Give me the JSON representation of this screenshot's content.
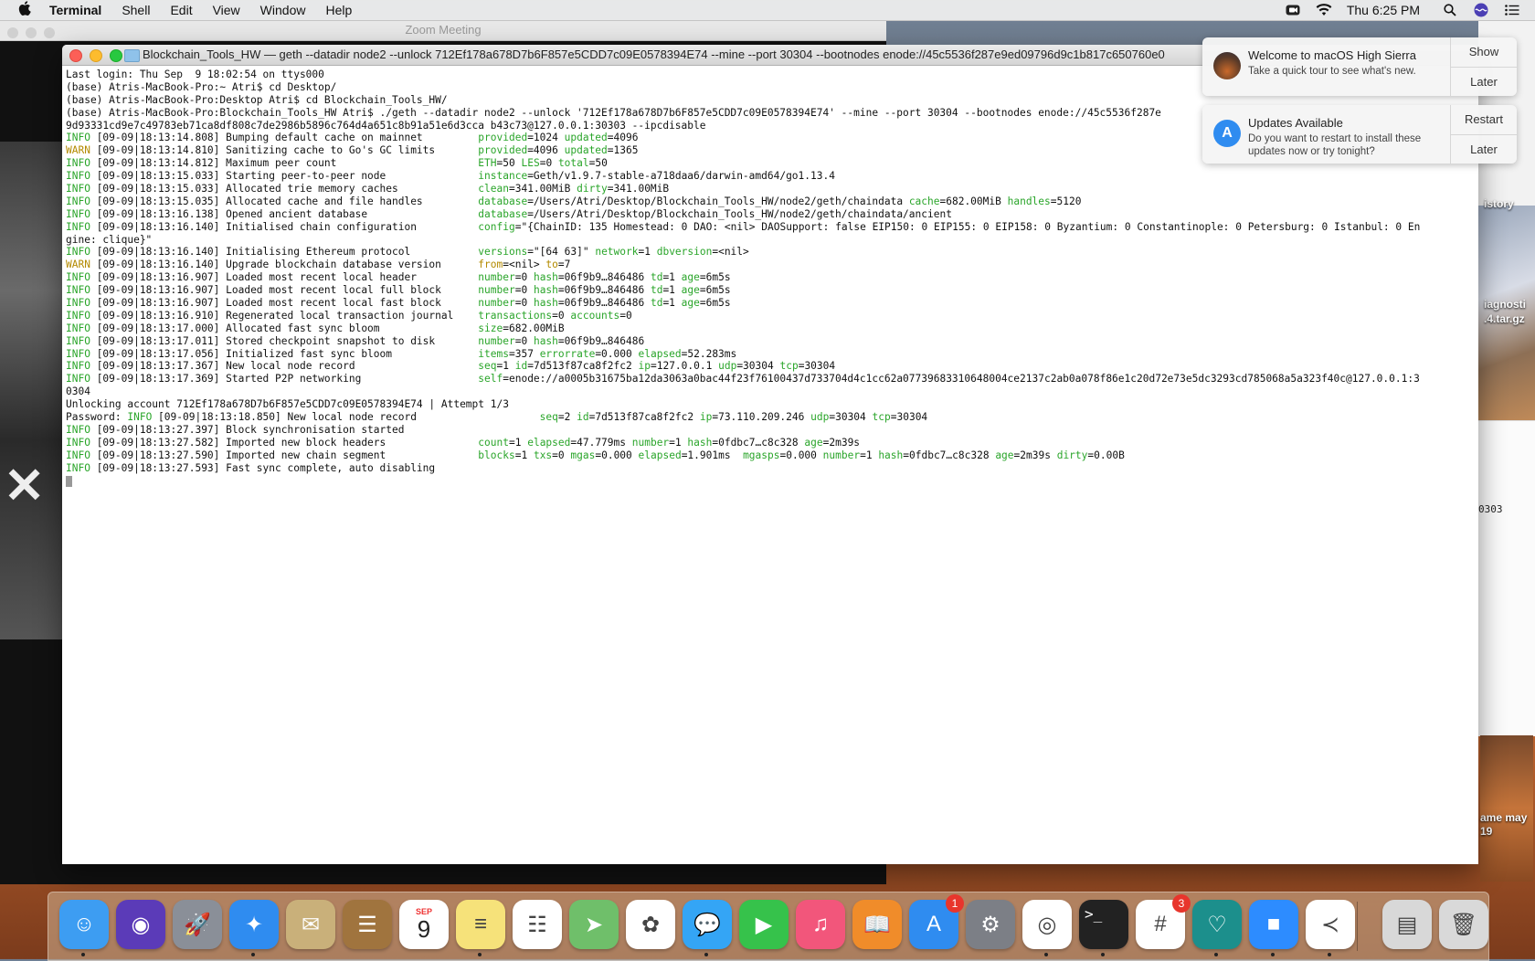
{
  "menubar": {
    "app_name": "Terminal",
    "items": [
      "Shell",
      "Edit",
      "View",
      "Window",
      "Help"
    ],
    "clock": "Thu 6:25 PM"
  },
  "zoom": {
    "title": "Zoom Meeting"
  },
  "terminal": {
    "title": "Blockchain_Tools_HW — geth --datadir node2 --unlock 712Ef178a678D7b6F857e5CDD7c09E0578394E74 --mine --port 30304 --bootnodes enode://45c5536f287e9ed09796d9c1b817c650760e0",
    "lines": [
      {
        "t": "Last login: Thu Sep  9 18:02:54 on ttys000"
      },
      {
        "t": "(base) Atris-MacBook-Pro:~ Atri$ cd Desktop/"
      },
      {
        "t": "(base) Atris-MacBook-Pro:Desktop Atri$ cd Blockchain_Tools_HW/"
      },
      {
        "t": "(base) Atris-MacBook-Pro:Blockchain_Tools_HW Atri$ ./geth --datadir node2 --unlock '712Ef178a678D7b6F857e5CDD7c09E0578394E74' --mine --port 30304 --bootnodes enode://45c5536f287e"
      },
      {
        "t": "9d93331cd9e7c49783eb71ca8df808c7de2986b5896c764d4a651c8b91a51e6d3cca b43c73@127.0.0.1:30303 --ipcdisable"
      },
      {
        "lvl": "INFO",
        "t": " [09-09|18:13:14.808] Bumping default cache on mainnet         ",
        "kv": "provided=1024 updated=4096"
      },
      {
        "lvl": "WARN",
        "t": " [09-09|18:13:14.810] Sanitizing cache to Go's GC limits       ",
        "kv": "provided=4096 updated=1365"
      },
      {
        "lvl": "INFO",
        "t": " [09-09|18:13:14.812] Maximum peer count                       ",
        "kv": "ETH=50 LES=0 total=50"
      },
      {
        "lvl": "INFO",
        "t": " [09-09|18:13:15.033] Starting peer-to-peer node               ",
        "kv": "instance=Geth/v1.9.7-stable-a718daa6/darwin-amd64/go1.13.4"
      },
      {
        "lvl": "INFO",
        "t": " [09-09|18:13:15.033] Allocated trie memory caches             ",
        "kv": "clean=341.00MiB dirty=341.00MiB"
      },
      {
        "lvl": "INFO",
        "t": " [09-09|18:13:15.035] Allocated cache and file handles         ",
        "kv": "database=/Users/Atri/Desktop/Blockchain_Tools_HW/node2/geth/chaindata cache=682.00MiB handles=5120"
      },
      {
        "lvl": "INFO",
        "t": " [09-09|18:13:16.138] Opened ancient database                  ",
        "kv": "database=/Users/Atri/Desktop/Blockchain_Tools_HW/node2/geth/chaindata/ancient"
      },
      {
        "lvl": "INFO",
        "t": " [09-09|18:13:16.140] Initialised chain configuration          ",
        "kv": "config=\"{ChainID: 135 Homestead: 0 DAO: <nil> DAOSupport: false EIP150: 0 EIP155: 0 EIP158: 0 Byzantium: 0 Constantinople: 0 Petersburg: 0 Istanbul: 0 En"
      },
      {
        "t": "gine: clique}\""
      },
      {
        "lvl": "INFO",
        "t": " [09-09|18:13:16.140] Initialising Ethereum protocol           ",
        "kv": "versions=\"[64 63]\" network=1 dbversion=<nil>"
      },
      {
        "lvl": "WARN",
        "t": " [09-09|18:13:16.140] Upgrade blockchain database version      ",
        "kv": "from=<nil> to=7"
      },
      {
        "lvl": "INFO",
        "t": " [09-09|18:13:16.907] Loaded most recent local header          ",
        "kv": "number=0 hash=06f9b9…846486 td=1 age=6m5s"
      },
      {
        "lvl": "INFO",
        "t": " [09-09|18:13:16.907] Loaded most recent local full block      ",
        "kv": "number=0 hash=06f9b9…846486 td=1 age=6m5s"
      },
      {
        "lvl": "INFO",
        "t": " [09-09|18:13:16.907] Loaded most recent local fast block      ",
        "kv": "number=0 hash=06f9b9…846486 td=1 age=6m5s"
      },
      {
        "lvl": "INFO",
        "t": " [09-09|18:13:16.910] Regenerated local transaction journal    ",
        "kv": "transactions=0 accounts=0"
      },
      {
        "lvl": "INFO",
        "t": " [09-09|18:13:17.000] Allocated fast sync bloom                ",
        "kv": "size=682.00MiB"
      },
      {
        "lvl": "INFO",
        "t": " [09-09|18:13:17.011] Stored checkpoint snapshot to disk       ",
        "kv": "number=0 hash=06f9b9…846486"
      },
      {
        "lvl": "INFO",
        "t": " [09-09|18:13:17.056] Initialized fast sync bloom              ",
        "kv": "items=357 errorrate=0.000 elapsed=52.283ms"
      },
      {
        "lvl": "INFO",
        "t": " [09-09|18:13:17.367] New local node record                    ",
        "kv": "seq=1 id=7d513f87ca8f2fc2 ip=127.0.0.1 udp=30304 tcp=30304"
      },
      {
        "lvl": "INFO",
        "t": " [09-09|18:13:17.369] Started P2P networking                   ",
        "kv": "self=enode://a0005b31675ba12da3063a0bac44f23f76100437d733704d4c1cc62a07739683310648004ce2137c2ab0a078f86e1c20d72e73e5dc3293cd785068a5a323f40c@127.0.0.1:3"
      },
      {
        "t": "0304"
      },
      {
        "t": "Unlocking account 712Ef178a678D7b6F857e5CDD7c09E0578394E74 | Attempt 1/3"
      },
      {
        "pre": "Password: ",
        "lvl": "INFO",
        "t": " [09-09|18:13:18.850] New local node record                    ",
        "kv": "seq=2 id=7d513f87ca8f2fc2 ip=73.110.209.246 udp=30304 tcp=30304"
      },
      {
        "lvl": "INFO",
        "t": " [09-09|18:13:27.397] Block synchronisation started"
      },
      {
        "lvl": "INFO",
        "t": " [09-09|18:13:27.582] Imported new block headers               ",
        "kv": "count=1 elapsed=47.779ms number=1 hash=0fdbc7…c8c328 age=2m39s"
      },
      {
        "lvl": "INFO",
        "t": " [09-09|18:13:27.590] Imported new chain segment               ",
        "kv": "blocks=1 txs=0 mgas=0.000 elapsed=1.901ms  mgasps=0.000 number=1 hash=0fdbc7…c8c328 age=2m39s dirty=0.00B"
      },
      {
        "lvl": "INFO",
        "t": " [09-09|18:13:27.593] Fast sync complete, auto disabling"
      }
    ]
  },
  "notifications": [
    {
      "title": "Welcome to macOS High Sierra",
      "body": "Take a quick tour to see what's new.",
      "buttons": [
        "Show",
        "Later"
      ]
    },
    {
      "title": "Updates Available",
      "body": "Do you want to restart to install these updates now or try tonight?",
      "buttons": [
        "Restart",
        "Later"
      ]
    }
  ],
  "desktop": {
    "labels": [
      "iagnosti",
      ".4.tar.gz",
      "istory",
      "ame may",
      "19",
      "0303"
    ]
  },
  "dock": {
    "items": [
      {
        "name": "finder-icon",
        "color": "#3d9df2",
        "glyph": "☺"
      },
      {
        "name": "siri-icon",
        "color": "#5b3bb8",
        "glyph": "◉"
      },
      {
        "name": "launchpad-icon",
        "color": "#8a8f98",
        "glyph": "🚀"
      },
      {
        "name": "safari-icon",
        "color": "#2f8cf0",
        "glyph": "✦"
      },
      {
        "name": "mail-icon",
        "color": "#c9b07a",
        "glyph": "✉"
      },
      {
        "name": "contacts-icon",
        "color": "#a0743e",
        "glyph": "☰"
      },
      {
        "name": "calendar-icon",
        "color": "#ffffff",
        "glyph": "9",
        "label": "SEP"
      },
      {
        "name": "notes-icon",
        "color": "#f6e27a",
        "glyph": "≡"
      },
      {
        "name": "reminders-icon",
        "color": "#ffffff",
        "glyph": "☷"
      },
      {
        "name": "maps-icon",
        "color": "#6fbf6a",
        "glyph": "➤"
      },
      {
        "name": "photos-icon",
        "color": "#ffffff",
        "glyph": "✿"
      },
      {
        "name": "messages-icon",
        "color": "#34a5f5",
        "glyph": "💬"
      },
      {
        "name": "facetime-icon",
        "color": "#36c24b",
        "glyph": "▶"
      },
      {
        "name": "itunes-icon",
        "color": "#f2567b",
        "glyph": "♫"
      },
      {
        "name": "ibooks-icon",
        "color": "#f08c2a",
        "glyph": "📖"
      },
      {
        "name": "app-store-icon",
        "color": "#2f8cf0",
        "glyph": "A",
        "badge": "1"
      },
      {
        "name": "system-preferences-icon",
        "color": "#7c7f86",
        "glyph": "⚙"
      },
      {
        "name": "chrome-icon",
        "color": "#ffffff",
        "glyph": "◎"
      },
      {
        "name": "terminal-icon",
        "color": "#222222",
        "glyph": ">_"
      },
      {
        "name": "slack-icon",
        "color": "#ffffff",
        "glyph": "#",
        "badge": "3"
      },
      {
        "name": "wave-app-icon",
        "color": "#1c8f8c",
        "glyph": "♡"
      },
      {
        "name": "zoom-icon",
        "color": "#2d8cff",
        "glyph": "■"
      },
      {
        "name": "vscode-icon",
        "color": "#ffffff",
        "glyph": "≺"
      },
      {
        "name": "documents-icon",
        "color": "#d8d8d8",
        "glyph": "▤"
      },
      {
        "name": "trash-icon",
        "color": "#d9d9d9",
        "glyph": "🗑"
      }
    ]
  }
}
